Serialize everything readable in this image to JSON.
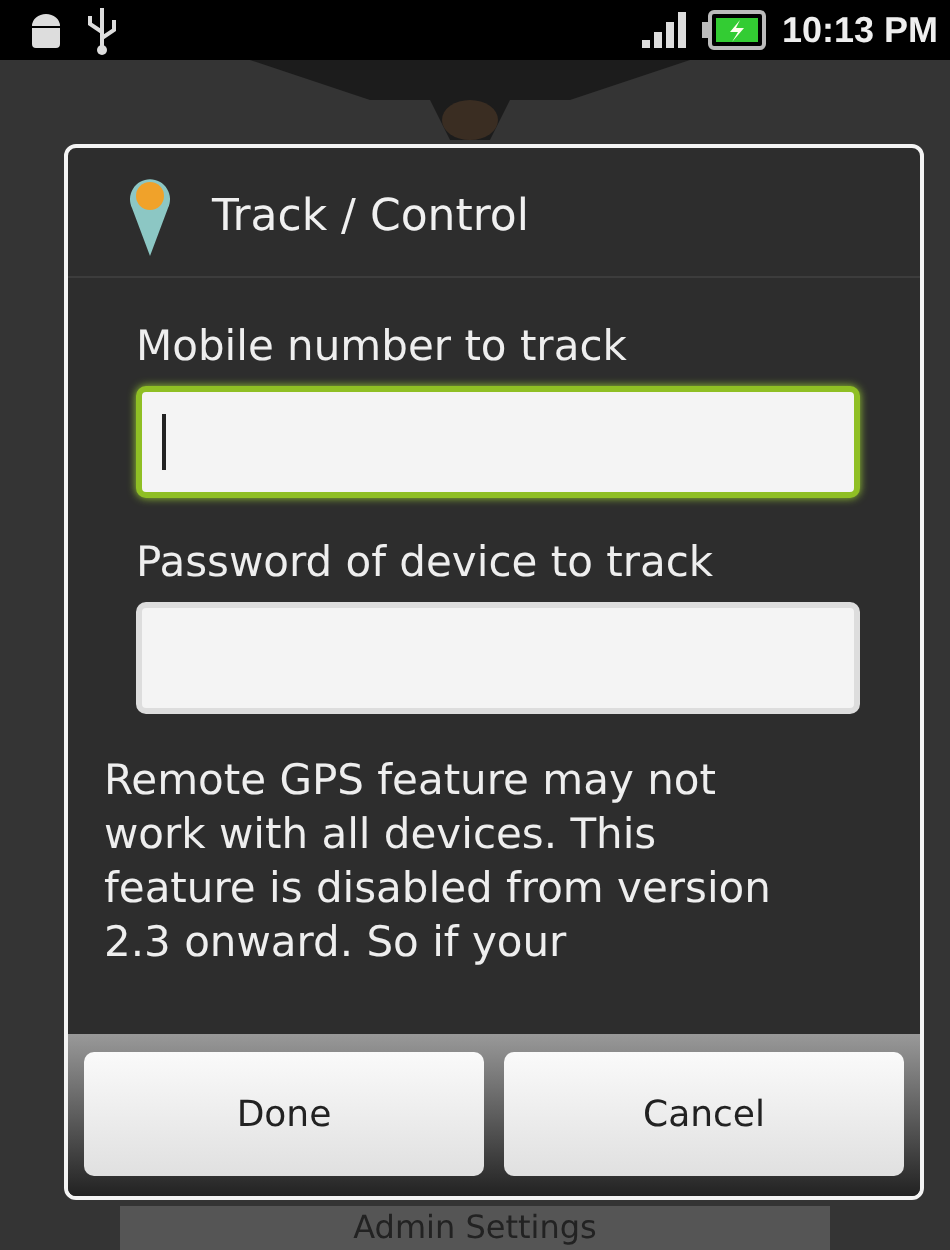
{
  "status_bar": {
    "time": "10:13 PM"
  },
  "dialog": {
    "title": "Track / Control",
    "fields": [
      {
        "label": "Mobile number to track",
        "focused": true
      },
      {
        "label": "Password of device to track",
        "focused": false
      }
    ],
    "message": "Remote GPS feature may not work with all devices. This feature is disabled from version 2.3 onward. So if your",
    "buttons": [
      "Done",
      "Cancel"
    ]
  },
  "background": {
    "item": "Admin Settings"
  }
}
